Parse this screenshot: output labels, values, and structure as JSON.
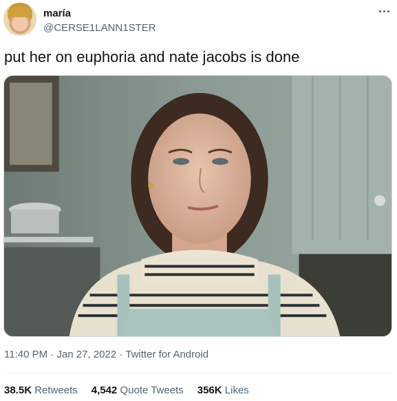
{
  "tweet": {
    "display_name": "maría",
    "handle": "@CERSE1LANN1STER",
    "text": "put her on euphoria and nate jacobs is done",
    "time": "11:40 PM",
    "date": "Jan 27, 2022",
    "source": "Twitter for Android",
    "separator": "·"
  },
  "stats": {
    "retweets_count": "38.5K",
    "retweets_label": "Retweets",
    "quotes_count": "4,542",
    "quotes_label": "Quote Tweets",
    "likes_count": "356K",
    "likes_label": "Likes"
  },
  "icons": {
    "more": "more-icon"
  }
}
